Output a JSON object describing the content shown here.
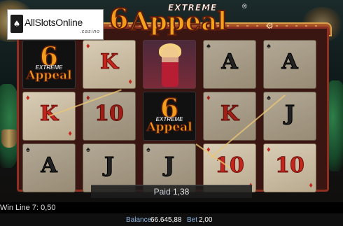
{
  "casino_badge": {
    "name": "AllSlotsOnline",
    "sub": ".casino",
    "icon": "card-icon"
  },
  "logo": {
    "number": "6",
    "top": "EXTREME",
    "main": "Appeal",
    "reg": "®"
  },
  "reels": [
    [
      "sym-6",
      "K-diamond",
      "A-spade"
    ],
    [
      "K-diamond",
      "10-diamond",
      "J-spade"
    ],
    [
      "lady",
      "sym-6",
      "J-spade"
    ],
    [
      "A-spade",
      "K-diamond",
      "10-diamond"
    ],
    [
      "A-spade",
      "J-spade",
      "10-diamond"
    ]
  ],
  "cards": {
    "r0c1": {
      "rank": "K",
      "suit": "♦"
    },
    "r0c2": {
      "rank": "A",
      "suit": "♠"
    },
    "r1c0": {
      "rank": "K",
      "suit": "♦"
    },
    "r1c1": {
      "rank": "10",
      "suit": "♦"
    },
    "r1c2": {
      "rank": "J",
      "suit": "♠"
    },
    "r2c2": {
      "rank": "J",
      "suit": "♠"
    },
    "r3c0": {
      "rank": "A",
      "suit": "♠"
    },
    "r3c1": {
      "rank": "K",
      "suit": "♦"
    },
    "r3c2": {
      "rank": "10",
      "suit": "♦"
    },
    "r4c0": {
      "rank": "A",
      "suit": "♠"
    },
    "r4c1": {
      "rank": "J",
      "suit": "♠"
    },
    "r4c2": {
      "rank": "10",
      "suit": "♦"
    }
  },
  "sym6": {
    "number": "6",
    "top": "EXTREME",
    "main": "Appeal"
  },
  "paid": {
    "label": "Paid",
    "value": "1,38"
  },
  "win_line": "Win Line 7: 0,50",
  "status": {
    "balance_label": "Balance",
    "balance_value": "66.645,88",
    "bet_label": "Bet",
    "bet_value": "2,00"
  },
  "settings_icon": "gear-icon",
  "colors": {
    "red_rank": "#c2261c",
    "logo_orange": "#f5a21d",
    "frame": "#8d3022",
    "status_label": "#8fb4e0"
  }
}
